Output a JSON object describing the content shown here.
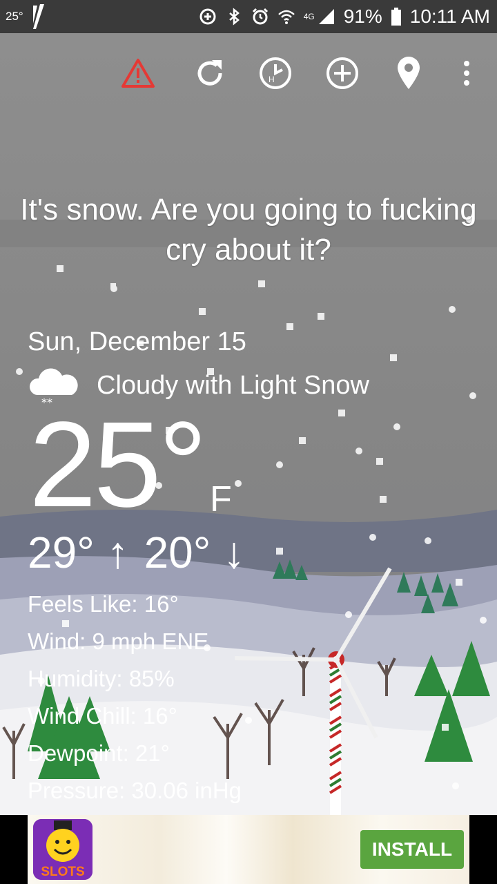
{
  "status_bar": {
    "temperature": "25°",
    "battery": "91%",
    "time": "10:11 AM",
    "network": "4G",
    "icons": [
      "app-logo-icon",
      "data-saver-icon",
      "bluetooth-icon",
      "alarm-icon",
      "wifi-icon",
      "signal-icon",
      "battery-icon"
    ]
  },
  "toolbar": {
    "icons": [
      "alert-icon",
      "refresh-icon",
      "hourly-clock-icon",
      "add-location-icon",
      "location-pin-icon",
      "overflow-menu-icon"
    ],
    "alert_color": "#e53935"
  },
  "headline": "It's snow. Are you going to fucking cry about it?",
  "weather": {
    "date": "Sun, December 15",
    "condition": "Cloudy with Light Snow",
    "condition_icon": "cloud-snow-icon",
    "temperature": "25°",
    "unit": "F",
    "high": "29° ↑",
    "low": "20° ↓",
    "details": [
      "Feels Like: 16°",
      "Wind: 9 mph ENE",
      "Humidity: 85%",
      "Wind Chill: 16°",
      "Dewpoint: 21°",
      "Pressure: 30.06 inHg"
    ]
  },
  "ad": {
    "app_label": "SLOTS",
    "button_label": "INSTALL",
    "button_color": "#5aa53f"
  }
}
